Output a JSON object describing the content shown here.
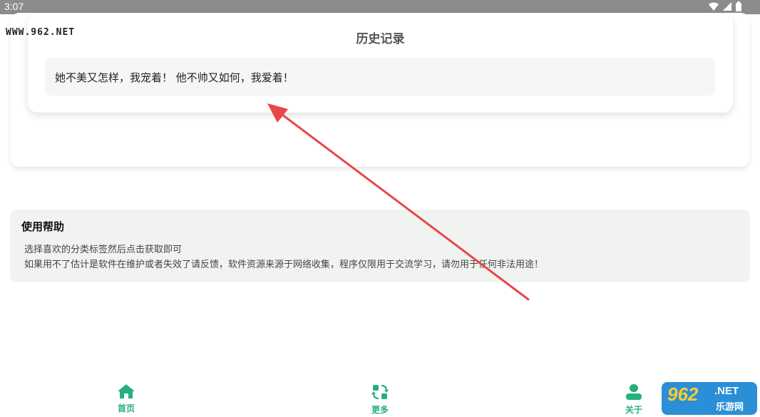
{
  "status_bar": {
    "time": "3:07",
    "icons": [
      "wifi-icon",
      "signal-icon",
      "battery-icon"
    ]
  },
  "watermark": {
    "top_text": "WWW.962.NET",
    "logo_number": "962",
    "logo_net": ".NET",
    "logo_cn": "乐游网"
  },
  "history": {
    "title": "历史记录",
    "items": [
      {
        "text": "她不美又怎样，我宠着！ 他不帅又如何，我爱着！"
      }
    ]
  },
  "help": {
    "title": "使用帮助",
    "lines": [
      "选择喜欢的分类标签然后点击获取即可",
      "如果用不了估计是软件在维护或者失效了请反馈，软件资源来源于网络收集，程序仅限用于交流学习，请勿用于任何非法用途！"
    ]
  },
  "nav": {
    "items": [
      {
        "label": "首页",
        "icon": "home-icon"
      },
      {
        "label": "更多",
        "icon": "swap-icon"
      },
      {
        "label": "关于",
        "icon": "user-icon"
      }
    ]
  },
  "colors": {
    "accent": "#26b07c",
    "arrow": "#e8474a",
    "status_bar": "#8c8c8c",
    "help_bg": "#f1f3f0"
  }
}
